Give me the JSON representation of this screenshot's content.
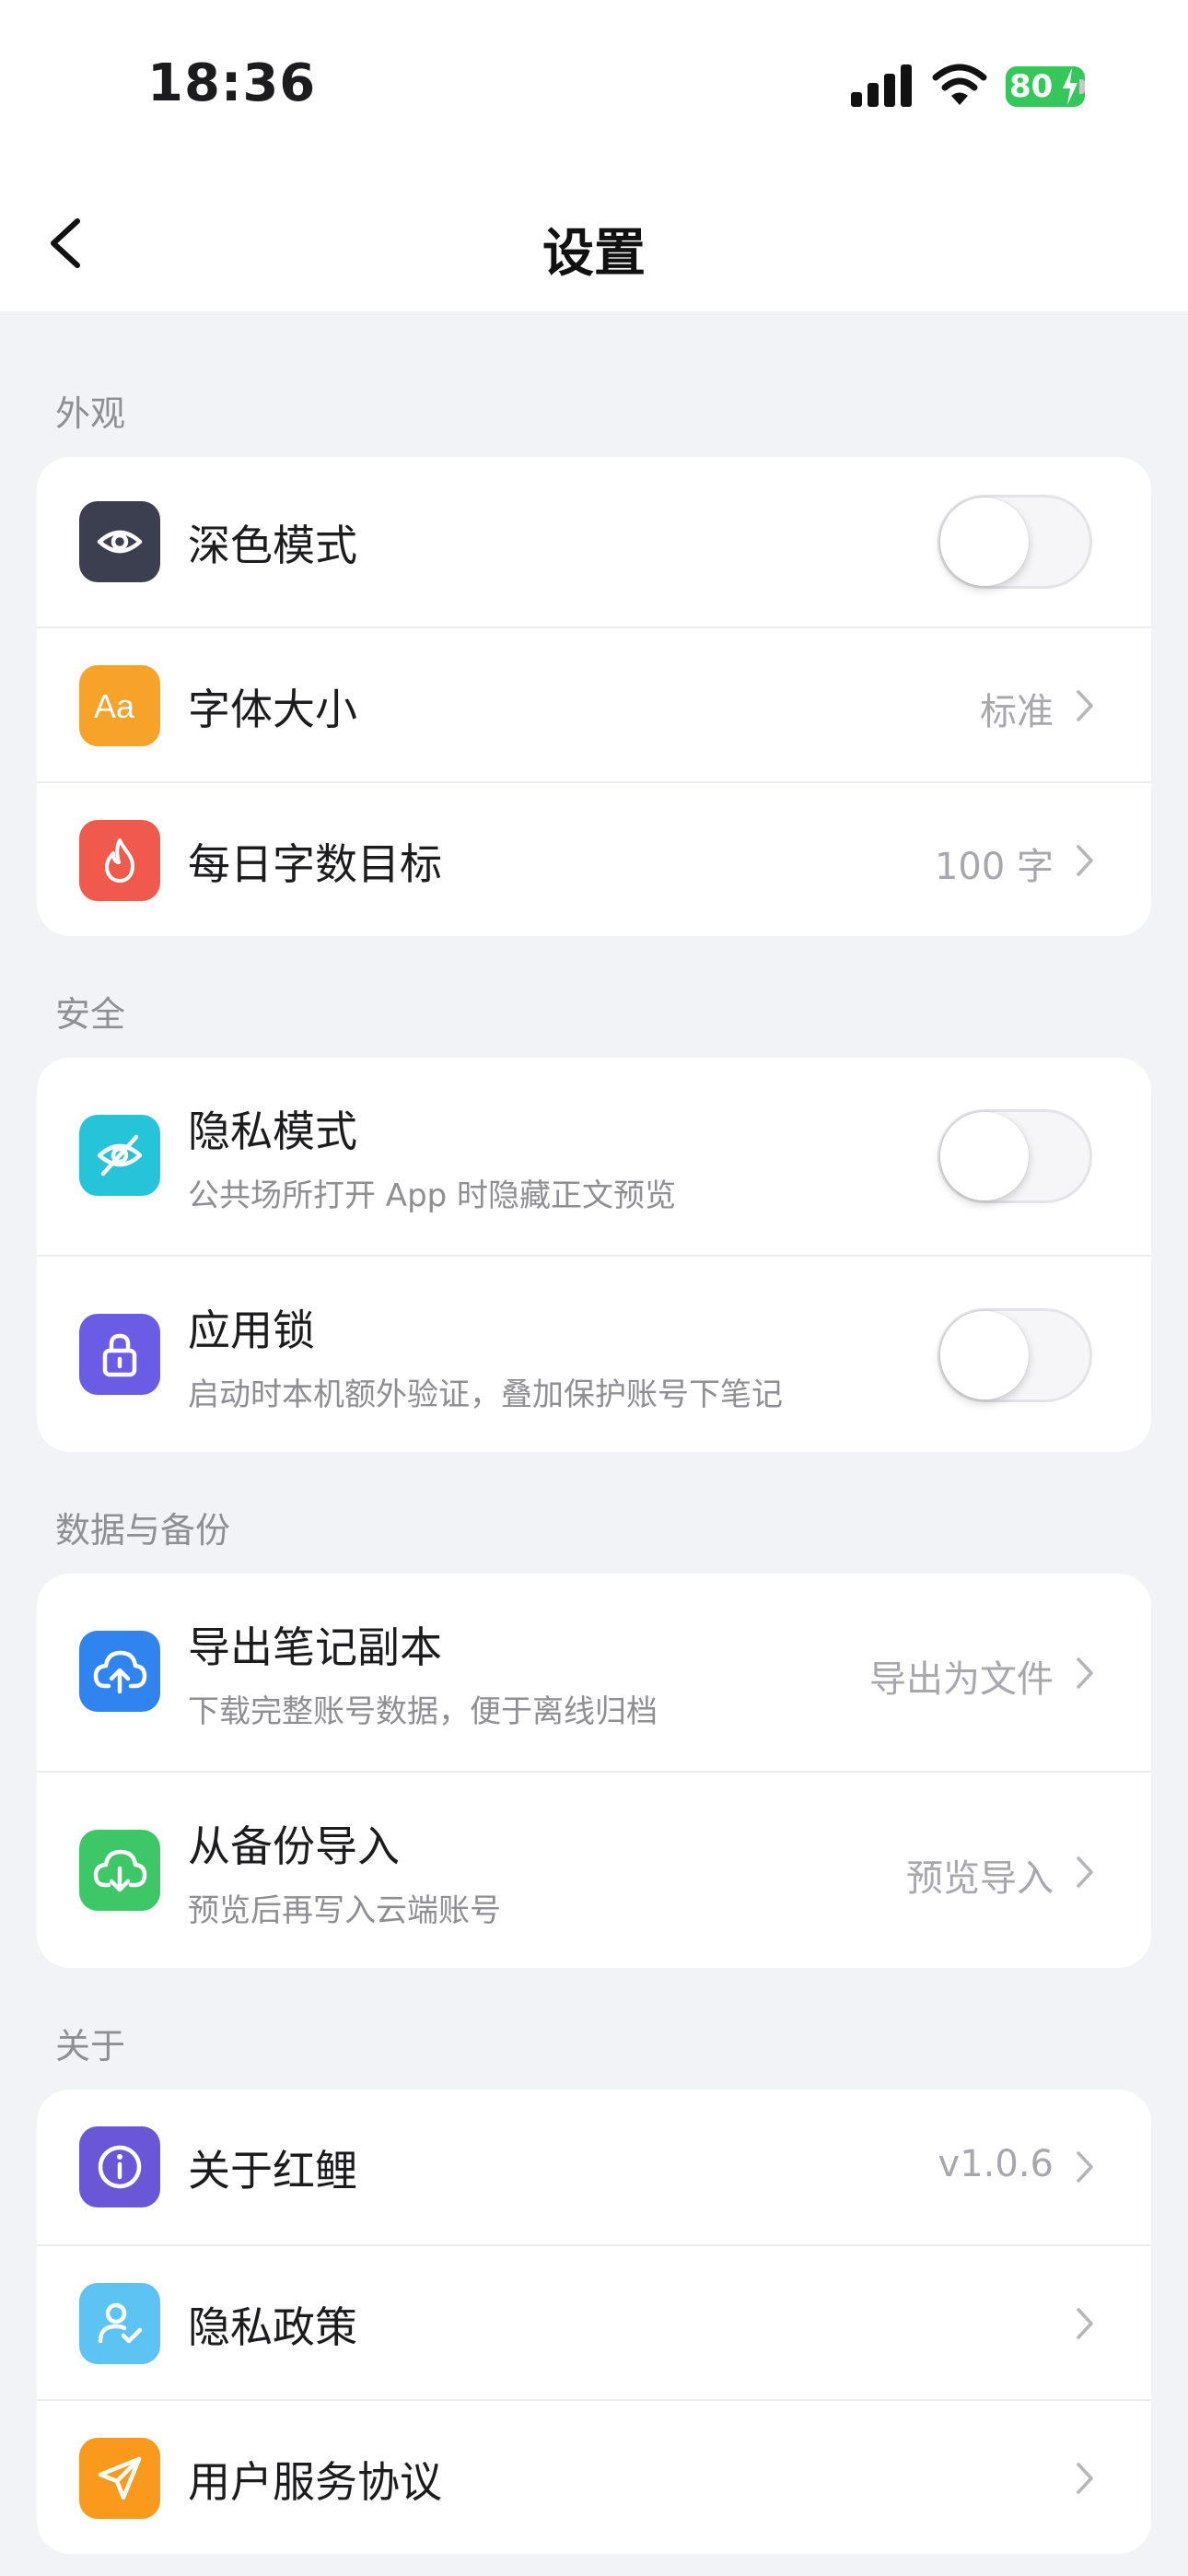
{
  "status_bar": {
    "time": "18:36",
    "battery": "80"
  },
  "nav": {
    "title": "设置"
  },
  "sections": [
    {
      "label": "外观",
      "items": [
        {
          "title": "深色模式",
          "control": "toggle",
          "on": false,
          "icon": "eye-icon",
          "color": "#3c3f4f"
        },
        {
          "title": "字体大小",
          "value": "标准",
          "control": "chevron",
          "icon": "font-size-icon",
          "color": "#f7a32a"
        },
        {
          "title": "每日字数目标",
          "value": "100 字",
          "control": "chevron",
          "icon": "flame-icon",
          "color": "#ef5a4c"
        }
      ]
    },
    {
      "label": "安全",
      "items": [
        {
          "title": "隐私模式",
          "subtitle": "公共场所打开 App 时隐藏正文预览",
          "control": "toggle",
          "on": false,
          "icon": "eye-off-icon",
          "color": "#25c4d8"
        },
        {
          "title": "应用锁",
          "subtitle": "启动时本机额外验证，叠加保护账号下笔记",
          "control": "toggle",
          "on": false,
          "icon": "lock-icon",
          "color": "#6b5ce6"
        }
      ]
    },
    {
      "label": "数据与备份",
      "items": [
        {
          "title": "导出笔记副本",
          "subtitle": "下载完整账号数据，便于离线归档",
          "value": "导出为文件",
          "control": "chevron",
          "icon": "cloud-upload-icon",
          "color": "#2f84f0"
        },
        {
          "title": "从备份导入",
          "subtitle": "预览后再写入云端账号",
          "value": "预览导入",
          "control": "chevron",
          "icon": "cloud-download-icon",
          "color": "#3ec766"
        }
      ]
    },
    {
      "label": "关于",
      "items": [
        {
          "title": "关于红鲤",
          "value": "v1.0.6",
          "control": "chevron",
          "icon": "info-icon",
          "color": "#6a57d8"
        },
        {
          "title": "隐私政策",
          "control": "chevron",
          "icon": "user-check-icon",
          "color": "#5cc3f2"
        },
        {
          "title": "用户服务协议",
          "control": "chevron",
          "icon": "send-icon",
          "color": "#f99a1c"
        }
      ]
    }
  ]
}
